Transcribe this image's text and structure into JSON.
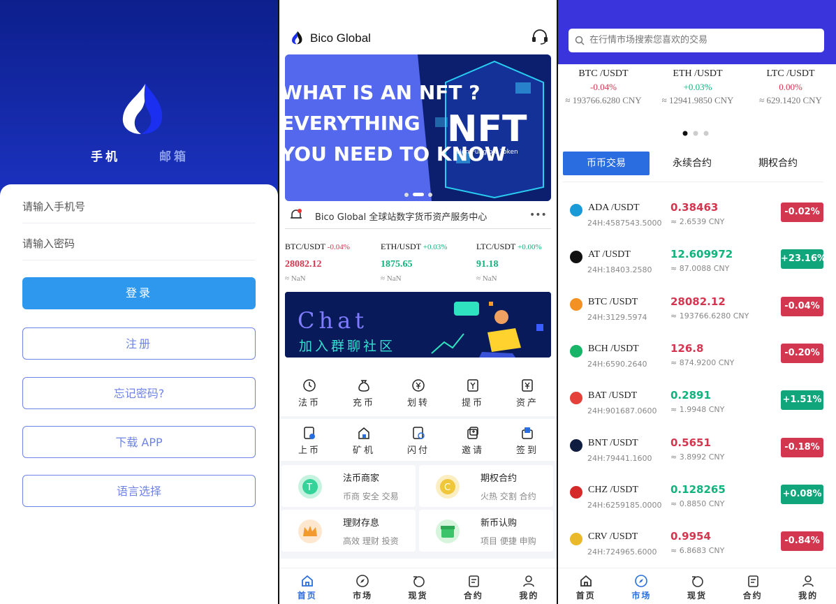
{
  "login": {
    "tab_phone": "手机",
    "tab_email": "邮箱",
    "phone_placeholder": "请输入手机号",
    "password_placeholder": "请输入密码",
    "login_button": "登录",
    "register_button": "注册",
    "forgot_button": "忘记密码?",
    "download_button": "下载 APP",
    "language_button": "语言选择"
  },
  "home": {
    "brand": "Bico Global",
    "banner": {
      "line1": "WHAT IS AN NFT ?",
      "line2": "EVERYTHING",
      "line3": "YOU NEED TO KNOW",
      "big": "NFT",
      "small": "Non-Fungible Token"
    },
    "notice": "Bico Global 全球站数字货币资产服务中心",
    "more": "•••",
    "tickers": [
      {
        "pair": "BTC/USDT",
        "change": "-0.04%",
        "price": "28082.12",
        "cny": "≈ NaN"
      },
      {
        "pair": "ETH/USDT",
        "change": "+0.03%",
        "price": "1875.65",
        "cny": "≈ NaN"
      },
      {
        "pair": "LTC/USDT",
        "change": "+0.00%",
        "price": "91.18",
        "cny": "≈ NaN"
      }
    ],
    "chat": {
      "title": "Chat",
      "subtitle": "加入群聊社区"
    },
    "grid_row1": [
      "法币",
      "充币",
      "划转",
      "提币",
      "资产"
    ],
    "grid_row2": [
      "上币",
      "矿机",
      "闪付",
      "邀请",
      "签到"
    ],
    "promos": [
      {
        "title": "法币商家",
        "sub": "币商 安全 交易"
      },
      {
        "title": "期权合约",
        "sub": "火热 交割 合约"
      },
      {
        "title": "理财存息",
        "sub": "高效 理财 投资"
      },
      {
        "title": "新币认购",
        "sub": "项目 便捷 申购"
      }
    ]
  },
  "nav": [
    "首页",
    "市场",
    "现货",
    "合约",
    "我的"
  ],
  "market": {
    "search_placeholder": "在行情市场搜索您喜欢的交易",
    "tickers": [
      {
        "pair": "BTC /USDT",
        "change": "-0.04%",
        "cny": "≈ 193766.6280 CNY"
      },
      {
        "pair": "ETH /USDT",
        "change": "+0.03%",
        "cny": "≈ 12941.9850 CNY"
      },
      {
        "pair": "LTC /USDT",
        "change": "0.00%",
        "cny": "≈ 629.1420 CNY"
      }
    ],
    "tabs": [
      "币币交易",
      "永续合约",
      "期权合约"
    ],
    "rows": [
      {
        "pair": "ADA /USDT",
        "vol": "24H:4587543.5000",
        "price": "0.38463",
        "cny": "≈ 2.6539 CNY",
        "change": "-0.02%",
        "dir": "down",
        "color": "#1a9bd8"
      },
      {
        "pair": "AT /USDT",
        "vol": "24H:18403.2580",
        "price": "12.609972",
        "cny": "≈ 87.0088 CNY",
        "change": "+23.16%",
        "dir": "up",
        "color": "#111111"
      },
      {
        "pair": "BTC /USDT",
        "vol": "24H:3129.5974",
        "price": "28082.12",
        "cny": "≈ 193766.6280 CNY",
        "change": "-0.04%",
        "dir": "down",
        "color": "#f39222"
      },
      {
        "pair": "BCH /USDT",
        "vol": "24H:6590.2640",
        "price": "126.8",
        "cny": "≈ 874.9200 CNY",
        "change": "-0.20%",
        "dir": "down",
        "color": "#18b468"
      },
      {
        "pair": "BAT /USDT",
        "vol": "24H:901687.0600",
        "price": "0.2891",
        "cny": "≈ 1.9948 CNY",
        "change": "+1.51%",
        "dir": "up",
        "color": "#e4413a"
      },
      {
        "pair": "BNT /USDT",
        "vol": "24H:79441.1600",
        "price": "0.5651",
        "cny": "≈ 3.8992 CNY",
        "change": "-0.18%",
        "dir": "down",
        "color": "#0f1d40"
      },
      {
        "pair": "CHZ /USDT",
        "vol": "24H:6259185.0000",
        "price": "0.128265",
        "cny": "≈ 0.8850 CNY",
        "change": "+0.08%",
        "dir": "up",
        "color": "#d42a2a"
      },
      {
        "pair": "CRV /USDT",
        "vol": "24H:724965.6000",
        "price": "0.9954",
        "cny": "≈ 6.8683 CNY",
        "change": "-0.84%",
        "dir": "down",
        "color": "#e9b92a"
      }
    ]
  }
}
